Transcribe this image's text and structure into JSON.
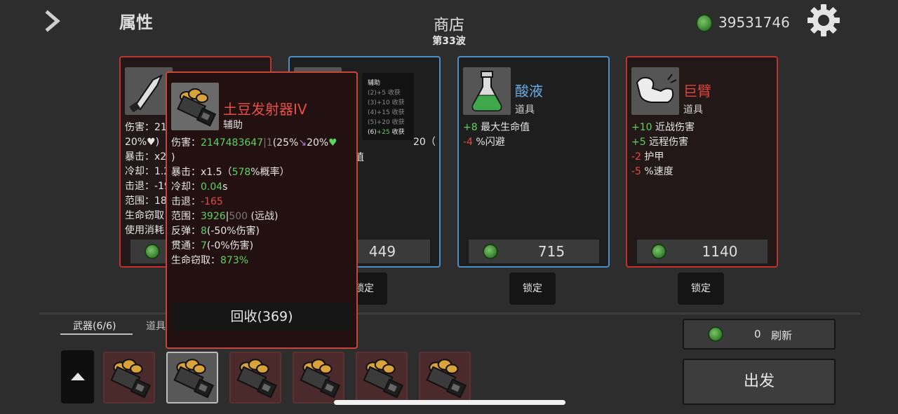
{
  "header": {
    "attributes_label": "属性",
    "shop_title": "商店",
    "wave": "第33波",
    "money": "39531746"
  },
  "colors": {
    "accent_red": "#c0322c",
    "accent_blue": "#4a8fc9",
    "positive": "#5fd35f",
    "negative": "#e44c43"
  },
  "cards": [
    {
      "visible_stats": [
        "伤害：21",
        "20%♥)",
        "暴击：x2",
        "冷却：1.2",
        "击退：-19",
        "范围：18",
        "生命窃取",
        "使用消耗"
      ],
      "lock": ""
    },
    {
      "price": "449",
      "frag1": "20（",
      "frag2": "值",
      "lock": "锁定"
    },
    {
      "name": "酸液",
      "type": "道具",
      "stats": [
        {
          "num": "+8",
          "text": " 最大生命值",
          "tone": "green"
        },
        {
          "num": "-4",
          "text": " %闪避",
          "tone": "red"
        }
      ],
      "price": "715",
      "lock": "锁定"
    },
    {
      "name": "巨臂",
      "type": "道具",
      "stats": [
        {
          "num": "+10",
          "text": " 近战伤害",
          "tone": "green"
        },
        {
          "num": "+5",
          "text": " 远程伤害",
          "tone": "green"
        },
        {
          "num": "-2",
          "text": " 护甲",
          "tone": "red"
        },
        {
          "num": "-5",
          "text": " %速度",
          "tone": "red"
        }
      ],
      "price": "1140",
      "lock": "锁定"
    }
  ],
  "tooltip": {
    "name": "土豆发射器IV",
    "type": "辅助",
    "damage_label": "伤害：",
    "damage_value": "2147483647",
    "damage_base": "1",
    "damage_pct": "(25%",
    "damage_pct2": "20%",
    "damage_close": ")",
    "crit_label": "暴击：",
    "crit_value": "x1.5（",
    "crit_chance": "578",
    "crit_suffix": "%概率）",
    "cooldown_label": "冷却：",
    "cooldown_value": "0.04",
    "cooldown_unit": "s",
    "knockback_label": "击退：",
    "knockback_value": "-165",
    "range_label": "范围：",
    "range_value": "3926",
    "range_base": "500",
    "range_suffix": "(远战)",
    "bounce_label": "反弹：",
    "bounce_value": "8",
    "bounce_suffix": "(-50%伤害)",
    "pierce_label": "贯通：",
    "pierce_value": "7",
    "pierce_suffix": "(-0%伤害)",
    "lifesteal_label": "生命窃取：",
    "lifesteal_value": "873%",
    "recycle": "回收(369)"
  },
  "harvest_popup": {
    "title": "辅助",
    "rows": [
      "(2)+5 收获",
      "(3)+10 收获",
      "(4)+15 收获",
      "(5)+20 收获"
    ],
    "active_row_prefix": "(6)",
    "active_row_value": "+25",
    "active_row_suffix": " 收获"
  },
  "inventory": {
    "weapons_tab": "武器(6/6)",
    "items_tab": "道具",
    "slot_count": 6,
    "selected_slot": 2
  },
  "actions": {
    "reroll_count": "0",
    "reroll_label": "刷新",
    "go_label": "出发"
  }
}
